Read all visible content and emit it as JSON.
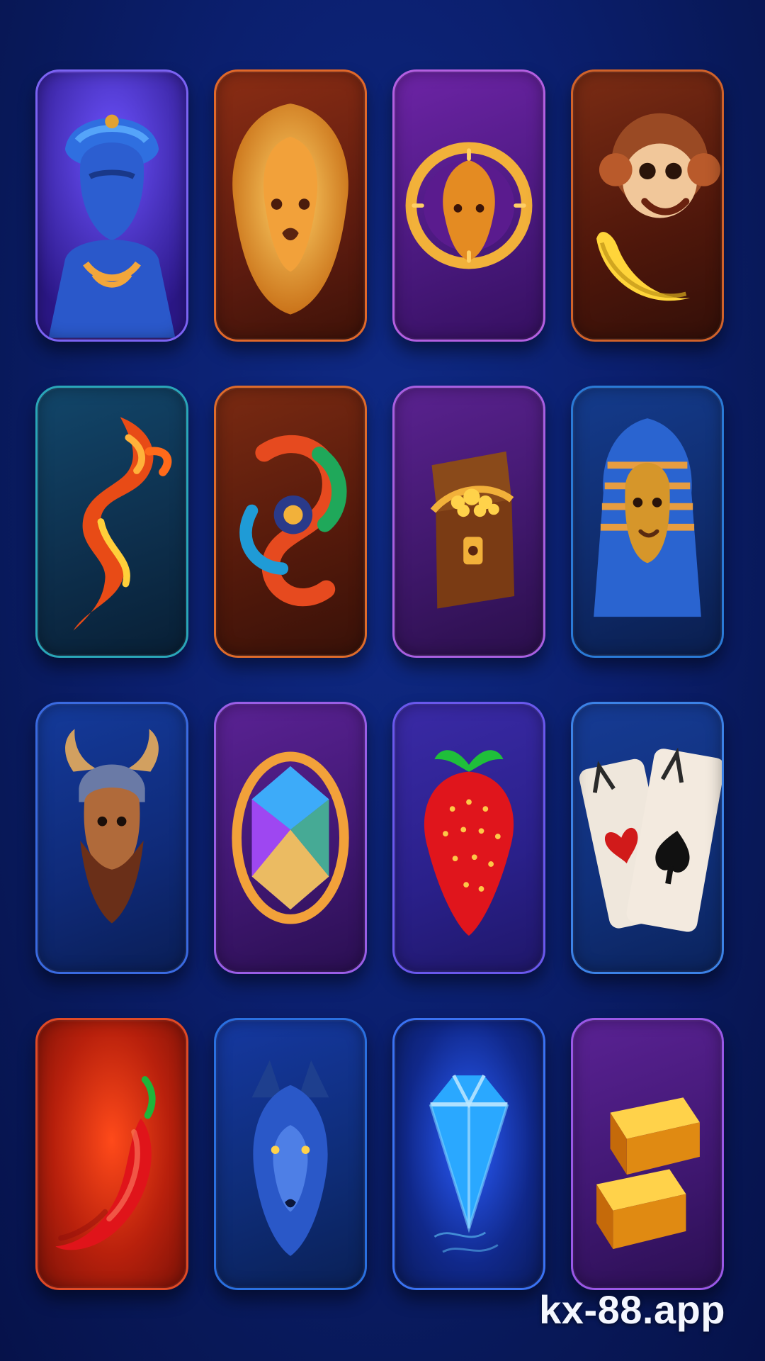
{
  "icons": [
    {
      "name": "genie-icon",
      "bg": "#4a2eb0",
      "frame": "#7a5af2"
    },
    {
      "name": "lion-icon",
      "bg": "#7a2a16",
      "frame": "#e06a2a"
    },
    {
      "name": "lion-clock-icon",
      "bg": "#5a1e86",
      "frame": "#b05ad6"
    },
    {
      "name": "monkey-banana-icon",
      "bg": "#6a2412",
      "frame": "#d06226"
    },
    {
      "name": "dragon-icon",
      "bg": "#123a5a",
      "frame": "#2aa6b8"
    },
    {
      "name": "ornament-swirl-icon",
      "bg": "#6b2310",
      "frame": "#de6b2b"
    },
    {
      "name": "treasure-chest-icon",
      "bg": "#4b1f7a",
      "frame": "#a85fe0"
    },
    {
      "name": "pharaoh-icon",
      "bg": "#0f2b6b",
      "frame": "#2a7ad6"
    },
    {
      "name": "viking-icon",
      "bg": "#0f2a78",
      "frame": "#3a6ae0"
    },
    {
      "name": "gem-medallion-icon",
      "bg": "#4a1d88",
      "frame": "#9a5ee6"
    },
    {
      "name": "strawberry-icon",
      "bg": "#2a2b8e",
      "frame": "#6a58ec"
    },
    {
      "name": "playing-cards-icon",
      "bg": "#10307a",
      "frame": "#3c82e6"
    },
    {
      "name": "chili-pepper-icon",
      "bg": "#8a1e0a",
      "frame": "#e04a26"
    },
    {
      "name": "wolf-icon",
      "bg": "#0e2c76",
      "frame": "#2a70e0"
    },
    {
      "name": "diamond-icon",
      "bg": "#10288a",
      "frame": "#3a72f2"
    },
    {
      "name": "gold-bars-icon",
      "bg": "#4a1d86",
      "frame": "#9a58e6"
    }
  ],
  "watermark": "kx-88.app"
}
